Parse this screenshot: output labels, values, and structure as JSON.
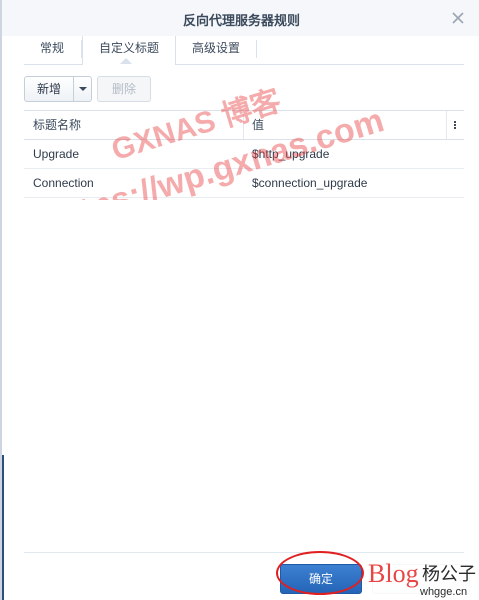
{
  "window": {
    "title": "反向代理服务器规则"
  },
  "tabs": [
    {
      "label": "常规"
    },
    {
      "label": "自定义标题"
    },
    {
      "label": "高级设置"
    }
  ],
  "toolbar": {
    "add_label": "新增",
    "delete_label": "删除"
  },
  "grid": {
    "columns": [
      "标题名称",
      "值"
    ],
    "rows": [
      {
        "name": "Upgrade",
        "value": "$http_upgrade"
      },
      {
        "name": "Connection",
        "value": "$connection_upgrade"
      }
    ]
  },
  "footer": {
    "ok_label": "确定"
  },
  "watermarks": {
    "line1": "GXNAS 博客",
    "line2": "https://wp.gxnas.com",
    "logo_word": "Blog",
    "logo_name": "杨公子",
    "logo_domain": "whgge.cn"
  },
  "colors": {
    "primary": "#2465b8",
    "annotation_red": "#e02020",
    "watermark_red": "#e84545"
  }
}
